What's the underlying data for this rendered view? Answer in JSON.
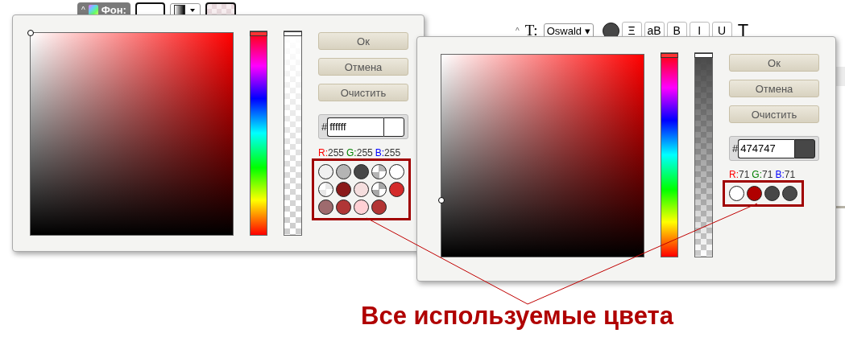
{
  "toolbar_background": {
    "collapse": "^",
    "label": "Фон:"
  },
  "toolbar_text": {
    "collapse": "^",
    "label": "T:",
    "font": "Oswald",
    "caret": "▾",
    "buttons": [
      "Ξ",
      "aB",
      "B",
      "I",
      "U"
    ],
    "plain": "T"
  },
  "pickers": [
    {
      "hue": {
        "level": 1
      },
      "opacity": {
        "level": 1
      },
      "buttons": [
        "Ок",
        "Отмена",
        "Очистить"
      ],
      "hash": "#",
      "hex": "ffffff",
      "rgb": [
        {
          "label": "R:",
          "value": "255"
        },
        {
          "label": "G:",
          "value": "255"
        },
        {
          "label": "B:",
          "value": "255"
        }
      ],
      "swatches": [
        {
          "kind": "solid",
          "color": "#f0f0f0"
        },
        {
          "kind": "solid",
          "color": "#b4b4b4"
        },
        {
          "kind": "solid",
          "color": "#474747"
        },
        {
          "kind": "checker",
          "color": "#b4b4b4"
        },
        {
          "kind": "solid",
          "color": "#ffffff"
        },
        {
          "kind": "checker",
          "color": "#e8e8e8"
        },
        {
          "kind": "solid",
          "color": "#8b1a1a"
        },
        {
          "kind": "solid",
          "color": "#f5dede"
        },
        {
          "kind": "checker",
          "color": "#a8a8a8"
        },
        {
          "kind": "solid",
          "color": "#d42a2a"
        },
        {
          "kind": "solid",
          "color": "#9e6b6e"
        },
        {
          "kind": "solid",
          "color": "#b03636"
        },
        {
          "kind": "solid",
          "color": "#ffd0d4"
        },
        {
          "kind": "solid",
          "color": "#b33434"
        }
      ]
    },
    {
      "hue": {
        "level": 1
      },
      "opacity": {
        "level": 1
      },
      "buttons": [
        "Ок",
        "Отмена",
        "Очистить"
      ],
      "hash": "#",
      "hex": "474747",
      "rgb": [
        {
          "label": "R:",
          "value": "71"
        },
        {
          "label": "G:",
          "value": "71"
        },
        {
          "label": "B:",
          "value": "71"
        }
      ],
      "swatches": [
        {
          "kind": "solid",
          "color": "#ffffff"
        },
        {
          "kind": "solid",
          "color": "#b00000"
        },
        {
          "kind": "solid",
          "color": "#474747"
        },
        {
          "kind": "solid",
          "color": "#4a4a4a"
        }
      ]
    }
  ],
  "annotation": {
    "text": "Все используемые цвета"
  }
}
